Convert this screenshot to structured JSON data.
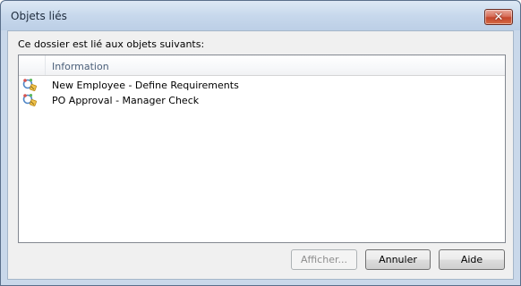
{
  "window": {
    "title": "Objets liés",
    "close_label": "✕"
  },
  "dialog": {
    "prompt": "Ce dossier est lié aux objets suivants:",
    "list": {
      "column_header": "Information",
      "items": [
        {
          "label": "New Employee - Define Requirements",
          "icon": "workflow-icon"
        },
        {
          "label": "PO Approval - Manager Check",
          "icon": "workflow-icon"
        }
      ]
    },
    "buttons": {
      "show_label": "Afficher...",
      "cancel_label": "Annuler",
      "help_label": "Aide"
    }
  }
}
